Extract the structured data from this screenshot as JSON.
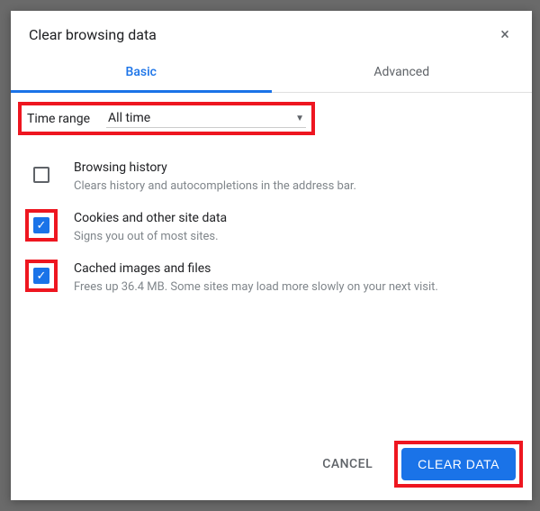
{
  "dialog": {
    "title": "Clear browsing data",
    "close_icon": "×"
  },
  "tabs": {
    "basic": "Basic",
    "advanced": "Advanced"
  },
  "time_range": {
    "label": "Time range",
    "value": "All time"
  },
  "options": [
    {
      "checked": false,
      "highlighted": false,
      "title": "Browsing history",
      "desc": "Clears history and autocompletions in the address bar."
    },
    {
      "checked": true,
      "highlighted": true,
      "title": "Cookies and other site data",
      "desc": "Signs you out of most sites."
    },
    {
      "checked": true,
      "highlighted": true,
      "title": "Cached images and files",
      "desc": "Frees up 36.4 MB. Some sites may load more slowly on your next visit."
    }
  ],
  "footer": {
    "cancel": "CANCEL",
    "clear": "CLEAR DATA"
  }
}
